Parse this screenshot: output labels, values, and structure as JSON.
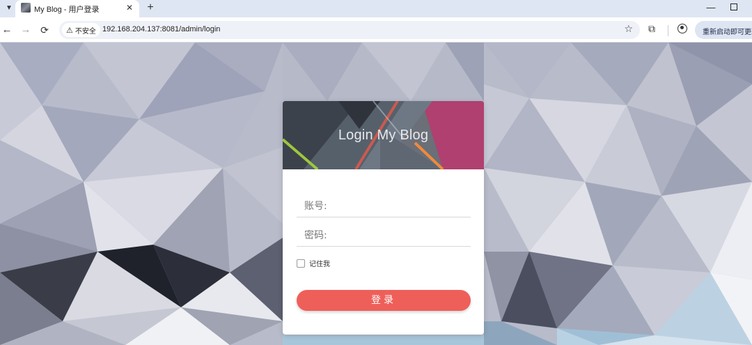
{
  "browser": {
    "tab_title": "My Blog - 用户登录",
    "tab_close": "✕",
    "new_tab": "+",
    "menu_icon": "chevron-down-icon",
    "minimize": "—",
    "back": "←",
    "forward": "→",
    "reload": "⟳",
    "security_label": "不安全",
    "warning_glyph": "⚠",
    "url": "192.168.204.137:8081/admin/login",
    "bookmark_glyph": "☆",
    "extensions_glyph": "⧉",
    "update_label": "重新启动即可更新"
  },
  "login": {
    "title": "Login My Blog",
    "username_placeholder": "账号:",
    "password_placeholder": "密码:",
    "remember_label": "记住我",
    "submit_label": "登录"
  },
  "colors": {
    "accent": "#ef5f5a",
    "tabstrip": "#dfe6f3",
    "omnibox": "#eef1f7"
  }
}
